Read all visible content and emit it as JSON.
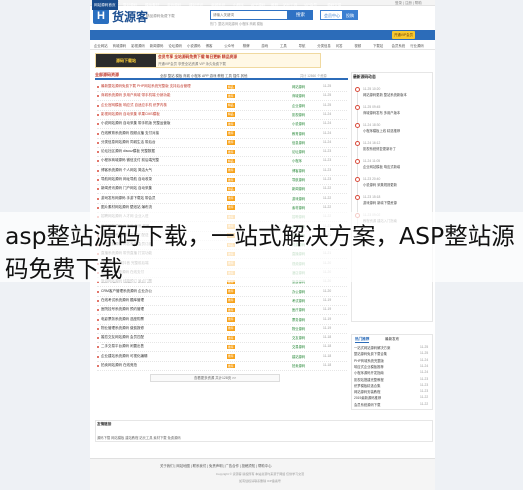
{
  "topbar": {
    "left": "欢迎来到货源客",
    "right": "登录 | 注册 | 帮助"
  },
  "logo": {
    "text": "货源客",
    "subtitle": "精品源码免费下载"
  },
  "search": {
    "placeholder": "请输入关键词",
    "button": "搜索"
  },
  "hot_keywords": "热门: 整站 网站源码 小程序 商城 模板",
  "top_buttons": [
    "会员中心",
    "投稿"
  ],
  "nav": {
    "items": [
      "网站源码首页",
      "整站源码",
      "模板素材",
      "游戏源码",
      "建站资讯",
      "商城系统",
      "小程序",
      "APP源码",
      "教程",
      "站长工具",
      "VIP会员",
      "源码交易"
    ],
    "vip": "开通VIP会员"
  },
  "subnav": [
    "企业网站",
    "商城源码",
    "影视源码",
    "新闻源码",
    "论坛源码",
    "小说源码",
    "博客",
    "公众号",
    "棋牌",
    "游戏",
    "工具",
    "导航",
    "分类信息",
    "问答",
    "视频",
    "下载站",
    "会员系统",
    "行业源码"
  ],
  "banner": {
    "ad": "源码下载站",
    "headline": "会员专享 全站源码免费下载 每日更新 精品资源",
    "sub": "开通VIP会员 享受全站资源 VIP 永久免费下载"
  },
  "list": {
    "title": "全部源码资源",
    "tabs": "全部 整站 模板 商城 小程序 APP 游戏 教程 工具 插件 其他",
    "count": "共计 12860 个资源",
    "rows": [
      {
        "title": "最新整站源码免费下载 PHP网站系统完整版 支持后台管理",
        "badge": "精品",
        "cat": "网站源码",
        "date": "11-25",
        "red": true
      },
      {
        "title": "商城系统源码 多用户商城 带手机端 分销功能",
        "badge": "推荐",
        "cat": "商城源码",
        "date": "11-25",
        "red": true
      },
      {
        "title": "企业官网模板 响应式 自适应手机 织梦内核",
        "badge": "精品",
        "cat": "企业源码",
        "date": "11-25",
        "red": true
      },
      {
        "title": "影视网站源码 自动采集 苹果CMS模板",
        "badge": "精品",
        "cat": "影视源码",
        "date": "11-24",
        "red": true
      },
      {
        "title": "小说网站源码 自动采集 带手机版 完整运营版",
        "badge": "推荐",
        "cat": "小说源码",
        "date": "11-24",
        "red": false
      },
      {
        "title": "在线教育系统源码 视频点播 支付对接",
        "badge": "推荐",
        "cat": "教育源码",
        "date": "11-24",
        "red": false
      },
      {
        "title": "分类信息网站源码 同城生活 带后台",
        "badge": "推荐",
        "cat": "信息源码",
        "date": "11-24",
        "red": false
      },
      {
        "title": "论坛社区源码 discuz模板 完整数据",
        "badge": "推荐",
        "cat": "论坛源码",
        "date": "11-23",
        "red": false
      },
      {
        "title": "小程序商城源码 微信支付 前后端完整",
        "badge": "精品",
        "cat": "小程序",
        "date": "11-23",
        "red": false
      },
      {
        "title": "博客系统源码 个人网站 简洁大气",
        "badge": "推荐",
        "cat": "博客源码",
        "date": "11-23",
        "red": false
      },
      {
        "title": "导航网站源码 网址导航 自动收录",
        "badge": "推荐",
        "cat": "导航源码",
        "date": "11-23",
        "red": false
      },
      {
        "title": "新闻资讯源码 门户网站 自动采集",
        "badge": "精品",
        "cat": "新闻源码",
        "date": "11-22",
        "red": false
      },
      {
        "title": "游戏发布网源码 手游下载站 带会员",
        "badge": "推荐",
        "cat": "游戏源码",
        "date": "11-22",
        "red": false
      },
      {
        "title": "图片素材网站源码 壁纸站 瀑布流",
        "badge": "推荐",
        "cat": "素材源码",
        "date": "11-22",
        "red": false
      },
      {
        "title": "招聘网站源码 人才网 企业入驻",
        "badge": "推荐",
        "cat": "招聘源码",
        "date": "11-22",
        "red": false
      },
      {
        "title": "房产网站源码 二手房 新房 租房",
        "badge": "推荐",
        "cat": "房产源码",
        "date": "11-21",
        "red": false
      },
      {
        "title": "外卖点餐系统源码 多商家 配送",
        "badge": "推荐",
        "cat": "外卖源码",
        "date": "11-21",
        "red": false
      },
      {
        "title": "知识付费源码 问答系统 会员订阅",
        "badge": "精品",
        "cat": "付费源码",
        "date": "11-21",
        "red": false
      },
      {
        "title": "直播系统源码 带货直播 打赏功能",
        "badge": "推荐",
        "cat": "直播源码",
        "date": "11-21",
        "red": false
      },
      {
        "title": "短视频源码 仿抖音 完整前后端",
        "badge": "推荐",
        "cat": "视频源码",
        "date": "11-20",
        "red": false
      },
      {
        "title": "酒店预订系统源码 在线支付",
        "badge": "推荐",
        "cat": "酒店源码",
        "date": "11-20",
        "red": false
      },
      {
        "title": "旅游网站源码 线路预订 景点门票",
        "badge": "推荐",
        "cat": "旅游源码",
        "date": "11-20",
        "red": false
      },
      {
        "title": "CRM客户管理系统源码 企业办公",
        "badge": "推荐",
        "cat": "办公源码",
        "date": "11-20",
        "red": false
      },
      {
        "title": "在线考试系统源码 题库管理",
        "badge": "推荐",
        "cat": "考试源码",
        "date": "11-19",
        "red": false
      },
      {
        "title": "医院挂号系统源码 预约管理",
        "badge": "推荐",
        "cat": "医疗源码",
        "date": "11-19",
        "red": false
      },
      {
        "title": "电影票务系统源码 选座购票",
        "badge": "推荐",
        "cat": "票务源码",
        "date": "11-19",
        "red": false
      },
      {
        "title": "物业管理系统源码 缴费报修",
        "badge": "推荐",
        "cat": "物业源码",
        "date": "11-19",
        "red": false
      },
      {
        "title": "婚恋交友网站源码 会员匹配",
        "badge": "推荐",
        "cat": "交友源码",
        "date": "11-18",
        "red": false
      },
      {
        "title": "二手交易平台源码 闲置出售",
        "badge": "推荐",
        "cat": "交易源码",
        "date": "11-18",
        "red": false
      },
      {
        "title": "企业建站系统源码 可视化编辑",
        "badge": "推荐",
        "cat": "建站源码",
        "date": "11-18",
        "red": false
      },
      {
        "title": "拍卖网站源码 在线竞拍",
        "badge": "推荐",
        "cat": "拍卖源码",
        "date": "11-18",
        "red": false
      }
    ]
  },
  "pagination": "查看更多资源 共计128页 >>",
  "sidebar": {
    "timeline_title": "最新源码动态",
    "timeline": [
      {
        "time": "11-25 10:20",
        "text": "网站源码更新 整站系统新版本"
      },
      {
        "time": "11-25 09:45",
        "text": "商城源码发布 多用户版本"
      },
      {
        "time": "11-24 18:30",
        "text": "小程序模板上线 精选推荐"
      },
      {
        "time": "11-24 16:12",
        "text": "影视系统修复更新补丁"
      },
      {
        "time": "11-24 11:05",
        "text": "企业网站模板 响应式新增"
      },
      {
        "time": "11-23 20:40",
        "text": "小说源码 采集规则更新"
      },
      {
        "time": "11-23 15:18",
        "text": "游戏源码 新增下载资源"
      },
      {
        "time": "11-23 09:02",
        "text": "教程资源 建站入门指南"
      }
    ],
    "tabs": [
      "热门推荐",
      "最新发布"
    ],
    "list": [
      {
        "text": "一站式网站源码解决方案",
        "date": "11-25"
      },
      {
        "text": "整站源码免费下载合集",
        "date": "11-25"
      },
      {
        "text": "PHP商城系统完整版",
        "date": "11-24"
      },
      {
        "text": "响应式企业模板推荐",
        "date": "11-24"
      },
      {
        "text": "小程序源码开发指南",
        "date": "11-24"
      },
      {
        "text": "影视站搭建完整教程",
        "date": "11-23"
      },
      {
        "text": "织梦模板精选合集",
        "date": "11-23"
      },
      {
        "text": "网站源码安装教程",
        "date": "11-23"
      },
      {
        "text": "2019最新源码推荐",
        "date": "11-22"
      },
      {
        "text": "会员系统源码下载",
        "date": "11-22"
      }
    ]
  },
  "friend_links": {
    "title": "友情链接",
    "links": "源码下载  网站模板  建站教程  站长工具  素材下载  免费源码"
  },
  "footer": {
    "links": "关于我们 | 网站地图 | 联系我们 | 免责声明 | 广告合作 | 投稿须知 | 帮助中心",
    "copyright": "Copyright © 货源客 版权所有 本站资源均来源于网络 仅供学习交流",
    "icp": "如有侵权请联系删除 ICP备案号"
  },
  "overlay": {
    "text": "asp整站源码下载，一站式解决方案，ASP整站源码免费下载"
  }
}
